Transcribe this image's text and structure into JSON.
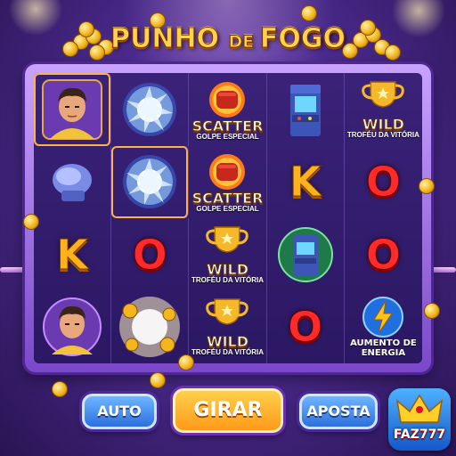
{
  "game": {
    "title_part1": "PUNHO ",
    "title_part2": "DE ",
    "title_part3": "FOGO"
  },
  "reels": [
    [
      {
        "symbol": "fighter-portrait"
      },
      {
        "symbol": "plasma-orb"
      },
      {
        "symbol": "fire-fist",
        "label": "SCATTER",
        "sublabel": "GOLPE ESPECIAL"
      },
      {
        "symbol": "arcade-cabinet"
      },
      {
        "symbol": "trophy",
        "label": "WILD",
        "sublabel": "TROFÉU DA VITÓRIA"
      }
    ],
    [
      {
        "symbol": "boxing-glove"
      },
      {
        "symbol": "plasma-orb"
      },
      {
        "symbol": "fire-fist",
        "label": "SCATTER",
        "sublabel": "GOLPE ESPECIAL"
      },
      {
        "symbol": "letter",
        "text": "K"
      },
      {
        "symbol": "letter",
        "text": "O"
      }
    ],
    [
      {
        "symbol": "letter",
        "text": "K"
      },
      {
        "symbol": "letter",
        "text": "O"
      },
      {
        "symbol": "trophy",
        "label": "WILD",
        "sublabel": "TROFÉU DA VITÓRIA"
      },
      {
        "symbol": "arcade-cabinet"
      },
      {
        "symbol": "letter",
        "text": "O"
      }
    ],
    [
      {
        "symbol": "fighter-portrait"
      },
      {
        "symbol": "coin-burst"
      },
      {
        "symbol": "trophy",
        "label": "WILD",
        "sublabel": "TROFÉU DA VITÓRIA"
      },
      {
        "symbol": "letter",
        "text": "O"
      },
      {
        "symbol": "lightning-badge",
        "label": "AUMENTO DE ENERGIA"
      }
    ]
  ],
  "controls": {
    "auto_label": "AUTO",
    "spin_label": "GIRAR",
    "bet_label": "APOSTA"
  },
  "brand": {
    "logo_text": "FAZ777"
  },
  "colors": {
    "letter_k": "#ffb21c",
    "letter_o": "#ff2a2a",
    "spin_button": "#ff9a1a",
    "side_buttons": "#2c6fe0"
  }
}
